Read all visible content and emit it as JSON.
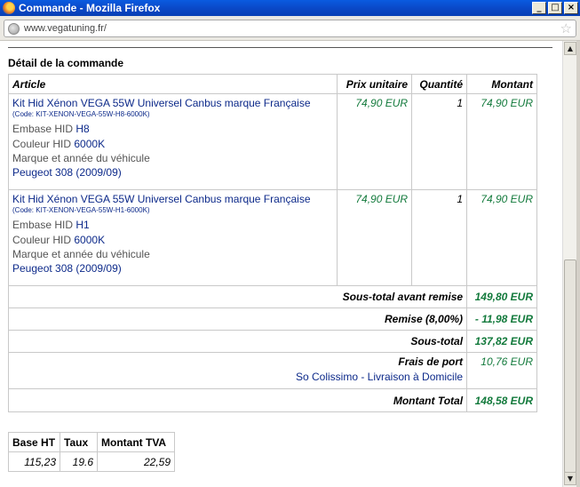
{
  "window": {
    "title": "Commande - Mozilla Firefox",
    "buttons": {
      "minimize": "_",
      "maximize": "□",
      "close": "×"
    }
  },
  "address": {
    "url": "www.vegatuning.fr/"
  },
  "section_title": "Détail de la commande",
  "order": {
    "headers": {
      "article": "Article",
      "unit_price": "Prix unitaire",
      "quantity": "Quantité",
      "amount": "Montant"
    },
    "rows": [
      {
        "name": "Kit Hid Xénon VEGA 55W Universel Canbus marque Française",
        "code": "(Code: KIT-XENON-VEGA-55W-H8-6000K)",
        "base_label": "Embase HID",
        "base_value": "H8",
        "color_label": "Couleur HID",
        "color_value": "6000K",
        "vehicle_label": "Marque et année du véhicule",
        "vehicle_value": "Peugeot 308 (2009/09)",
        "unit_price": "74,90 EUR",
        "quantity": "1",
        "amount": "74,90 EUR"
      },
      {
        "name": "Kit Hid Xénon VEGA 55W Universel Canbus marque Française",
        "code": "(Code: KIT-XENON-VEGA-55W-H1-6000K)",
        "base_label": "Embase HID",
        "base_value": "H1",
        "color_label": "Couleur HID",
        "color_value": "6000K",
        "vehicle_label": "Marque et année du véhicule",
        "vehicle_value": "Peugeot 308 (2009/09)",
        "unit_price": "74,90 EUR",
        "quantity": "1",
        "amount": "74,90 EUR"
      }
    ],
    "totals": {
      "subtotal_before_discount_label": "Sous-total avant remise",
      "subtotal_before_discount": "149,80 EUR",
      "discount_label": "Remise (8,00%)",
      "discount": "- 11,98 EUR",
      "subtotal_label": "Sous-total",
      "subtotal": "137,82 EUR",
      "shipping_label": "Frais de port",
      "shipping_method": "So Colissimo - Livraison à Domicile",
      "shipping": "10,76 EUR",
      "total_label": "Montant Total",
      "total": "148,58 EUR"
    }
  },
  "tva": {
    "headers": {
      "base": "Base HT",
      "rate": "Taux",
      "amount": "Montant TVA"
    },
    "row": {
      "base": "115,23",
      "rate": "19.6",
      "amount": "22,59"
    }
  },
  "scrollbar": {
    "up": "▲",
    "down": "▼"
  },
  "colors": {
    "title_bar": "#0a49c8",
    "link_blue": "#0d2a8a",
    "price_green": "#137a3c"
  }
}
